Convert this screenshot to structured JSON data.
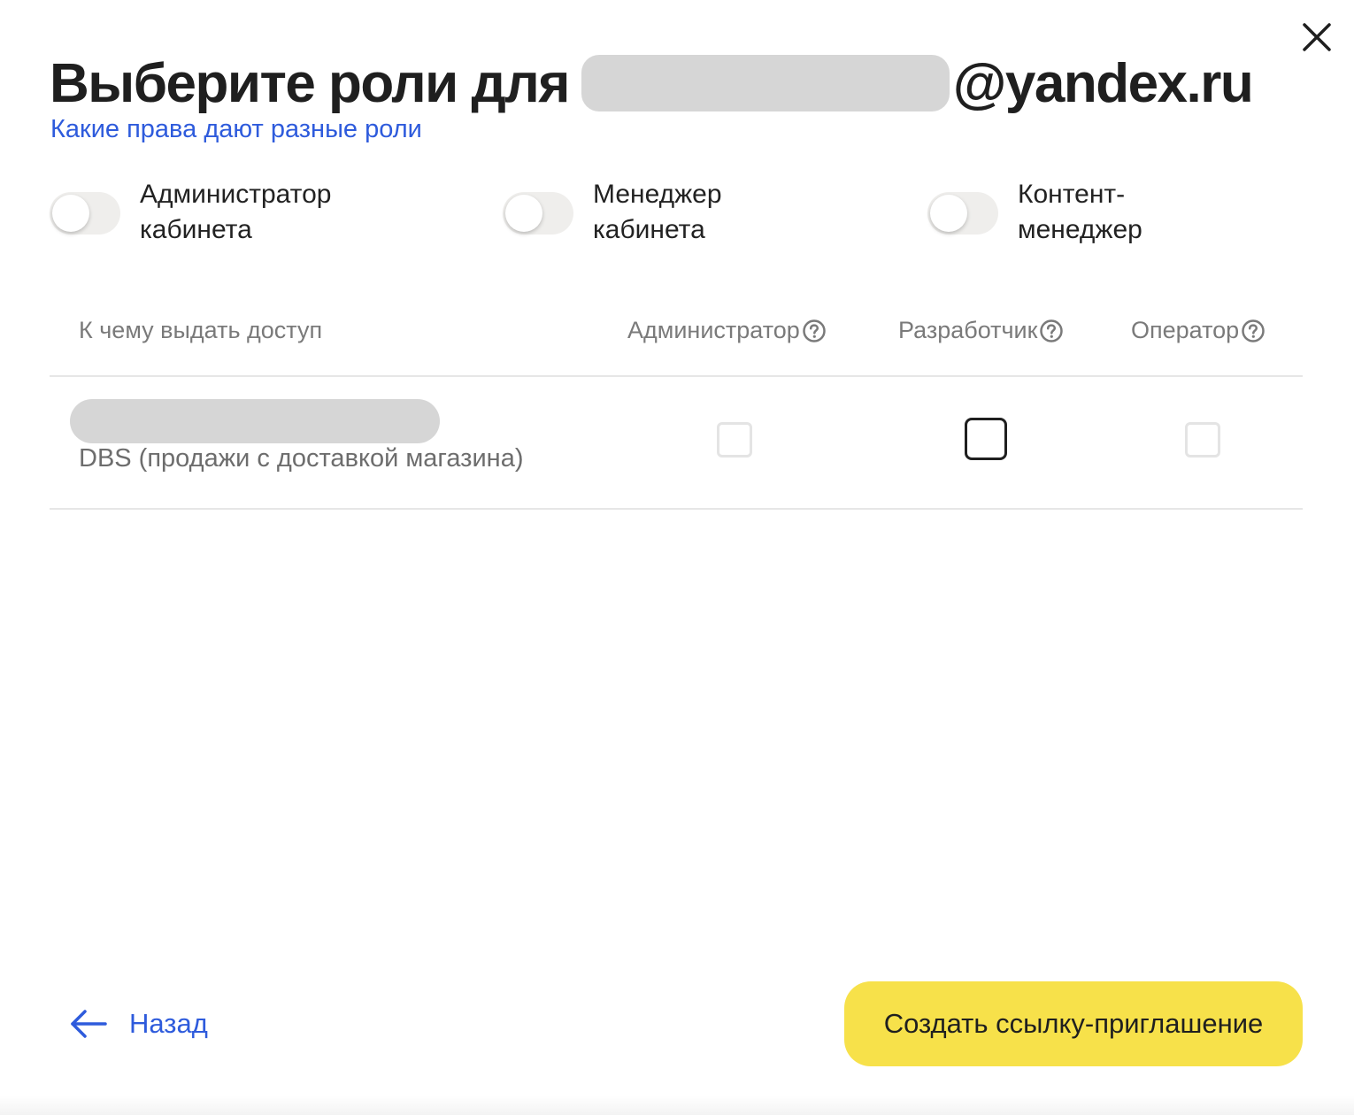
{
  "dialog": {
    "title_prefix": "Выберите роли для",
    "title_suffix": "@yandex.ru",
    "roles_link": "Какие права дают разные роли"
  },
  "presets": [
    {
      "label": "Администратор\nкабинета",
      "enabled": false
    },
    {
      "label": "Менеджер\nкабинета",
      "enabled": false
    },
    {
      "label": "Контент-\nменеджер",
      "enabled": false
    }
  ],
  "table": {
    "columns": {
      "target": "К чему выдать доступ",
      "admin": "Администратор",
      "developer": "Разработчик",
      "operator": "Оператор"
    },
    "rows": [
      {
        "subtitle": "DBS (продажи с доставкой магазина)",
        "admin_checked": false,
        "developer_checked": false,
        "operator_checked": false
      }
    ]
  },
  "footer": {
    "back_label": "Назад",
    "create_label": "Создать ссылку-приглашение"
  },
  "colors": {
    "link": "#2e5bdc",
    "primary_button": "#f7e14a",
    "toggle_track": "#efeeec",
    "redacted": "#d6d6d6"
  },
  "icons": {
    "close": "close-icon",
    "help": "question-circle-icon",
    "back": "arrow-left-icon"
  }
}
